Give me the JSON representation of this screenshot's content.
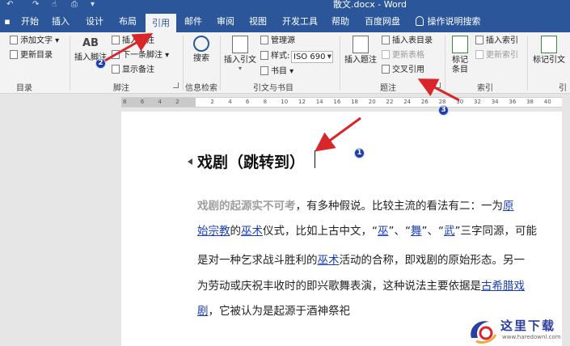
{
  "titlebar": {
    "title": "散文.docx - Word",
    "qa_undo": "↶",
    "qa_redo": "↷"
  },
  "tabs": [
    {
      "key": "start",
      "label": "开始"
    },
    {
      "key": "insert",
      "label": "插入"
    },
    {
      "key": "design",
      "label": "设计"
    },
    {
      "key": "layout",
      "label": "布局"
    },
    {
      "key": "references",
      "label": "引用",
      "active": true
    },
    {
      "key": "mailings",
      "label": "邮件"
    },
    {
      "key": "review",
      "label": "审阅"
    },
    {
      "key": "view",
      "label": "视图"
    },
    {
      "key": "developer",
      "label": "开发工具"
    },
    {
      "key": "help",
      "label": "帮助"
    },
    {
      "key": "baidu",
      "label": "百度网盘"
    },
    {
      "key": "tellme",
      "label": "操作说明搜索"
    }
  ],
  "ribbon": {
    "toc": {
      "add_text": "添加文字",
      "update_toc": "更新目录",
      "group": "目录"
    },
    "footnote": {
      "insert_footnote": "插入脚注",
      "insert_endnote": "插入尾注",
      "next_footnote": "下一条脚注",
      "show_notes": "显示备注",
      "group": "脚注",
      "ab_mark": "AB"
    },
    "research": {
      "search": "搜索",
      "group": "信息检索"
    },
    "citations": {
      "insert_citation": "插入引文",
      "manage_sources": "管理源",
      "style_label": "样式:",
      "style_value": "ISO 690",
      "bibliography": "书目",
      "group": "引文与书目"
    },
    "captions": {
      "insert_caption": "插入题注",
      "insert_table_of_figures": "插入表目录",
      "update_table": "更新表格",
      "cross_reference": "交叉引用",
      "group": "题注"
    },
    "index": {
      "mark_entry": "标记条目",
      "insert_index": "插入索引",
      "update_index": "更新索引",
      "group": "索引"
    },
    "toa": {
      "mark_citation": "标记引文",
      "group": "引"
    }
  },
  "ruler": {
    "ticks": [
      "8",
      "6",
      "4",
      "2",
      "",
      "2",
      "4",
      "6",
      "8",
      "10",
      "12",
      "14",
      "16",
      "18",
      "20",
      "22",
      "24",
      "26",
      "28",
      "30",
      "32",
      "34",
      "36",
      "38",
      "40"
    ]
  },
  "document": {
    "heading": "戏剧（跳转到）",
    "lines": [
      {
        "parts": [
          {
            "t": "lead",
            "v": "戏剧的起源实不可考"
          },
          {
            "t": "text",
            "v": "，有多种假说。比较主流的看法有二：一为"
          },
          {
            "t": "link",
            "v": "原"
          }
        ]
      },
      {
        "parts": [
          {
            "t": "link",
            "v": "始宗教"
          },
          {
            "t": "text",
            "v": "的"
          },
          {
            "t": "link",
            "v": "巫术"
          },
          {
            "t": "text",
            "v": "仪式，比如上古中文，“"
          },
          {
            "t": "link",
            "v": "巫"
          },
          {
            "t": "text",
            "v": "”、“"
          },
          {
            "t": "link",
            "v": "舞"
          },
          {
            "t": "text",
            "v": "”、“"
          },
          {
            "t": "link",
            "v": "武"
          },
          {
            "t": "text",
            "v": "”三字同源，可能"
          }
        ]
      },
      {
        "parts": [
          {
            "t": "text",
            "v": "是对一种乞求战斗胜利的"
          },
          {
            "t": "link",
            "v": "巫术"
          },
          {
            "t": "text",
            "v": "活动的合称，即戏剧的原始形态。另一"
          }
        ]
      },
      {
        "parts": [
          {
            "t": "text",
            "v": "为劳动或庆祝丰收时的即兴歌舞表演，这种说法主要依据是"
          },
          {
            "t": "link",
            "v": "古希腊戏"
          }
        ]
      },
      {
        "parts": [
          {
            "t": "link",
            "v": "剧"
          },
          {
            "t": "text",
            "v": "，它被认为是起源于酒神祭祀"
          }
        ]
      }
    ]
  },
  "annotations": {
    "badge1": "1",
    "badge2": "2",
    "badge3": "3",
    "arrow_color": "#d9262b"
  },
  "watermark": {
    "text": "这里下载",
    "url": "www.haredownl.com"
  },
  "colors": {
    "word_blue": "#2b579a",
    "link": "#1a3fb5",
    "badge": "#1f3fa8"
  }
}
